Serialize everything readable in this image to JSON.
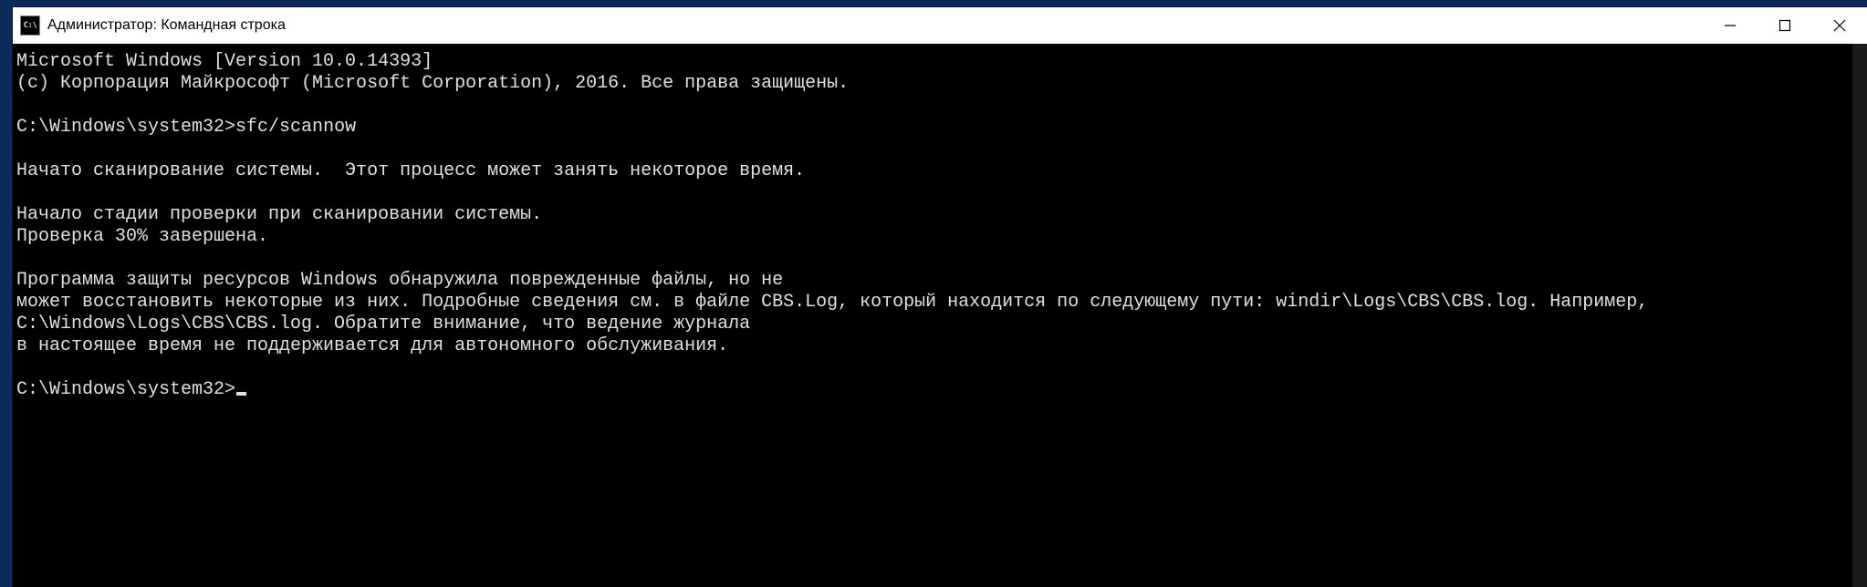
{
  "titlebar": {
    "icon_label": "C:\\",
    "title": "Администратор: Командная строка"
  },
  "terminal": {
    "line_version": "Microsoft Windows [Version 10.0.14393]",
    "line_copyright": "(с) Корпорация Майкрософт (Microsoft Corporation), 2016. Все права защищены.",
    "blank1": "",
    "prompt1": "C:\\Windows\\system32>",
    "command1": "sfc/scannow",
    "blank2": "",
    "line_scan_started": "Начато сканирование системы.  Этот процесс может занять некоторое время.",
    "blank3": "",
    "line_verify_stage": "Начало стадии проверки при сканировании системы.",
    "line_progress": "Проверка 30% завершена.",
    "blank4": "",
    "line_result1": "Программа защиты ресурсов Windows обнаружила поврежденные файлы, но не",
    "line_result2": "может восстановить некоторые из них. Подробные сведения см. в файле CBS.Log, который находится по следующему пути: windir\\Logs\\CBS\\CBS.log. Например,",
    "line_result3": "C:\\Windows\\Logs\\CBS\\CBS.log. Обратите внимание, что ведение журнала",
    "line_result4": "в настоящее время не поддерживается для автономного обслуживания.",
    "blank5": "",
    "prompt2": "C:\\Windows\\system32>"
  }
}
